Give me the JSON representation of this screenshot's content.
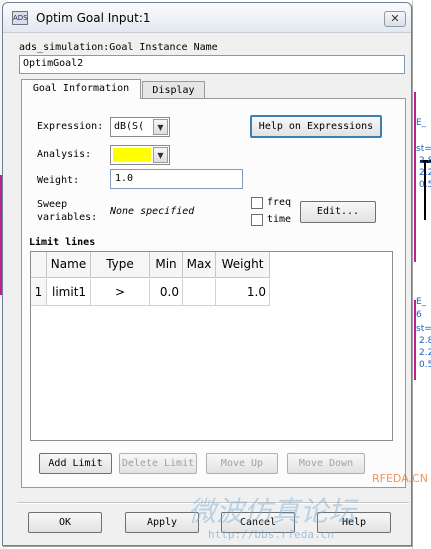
{
  "window": {
    "title": "Optim Goal Input:1",
    "close_symbol": "✕",
    "icon_text": "ADS"
  },
  "instance": {
    "label": "ads_simulation:Goal Instance Name",
    "value": "OptimGoal2"
  },
  "tabs": [
    {
      "label": "Goal Information",
      "active": true
    },
    {
      "label": "Display",
      "active": false
    }
  ],
  "form": {
    "expression_label": "Expression:",
    "expression_value": "dB(S(",
    "help_button": "Help on Expressions",
    "analysis_label": "Analysis:",
    "analysis_value": "",
    "analysis_color": "#ffff00",
    "weight_label": "Weight:",
    "weight_value": "1.0",
    "sweep_label_1": "Sweep",
    "sweep_label_2": "variables:",
    "sweep_value": "None specified",
    "freq_label": "freq",
    "time_label": "time",
    "edit_button": "Edit..."
  },
  "limit_lines": {
    "title": "Limit lines",
    "columns": [
      "Name",
      "Type",
      "Min",
      "Max",
      "Weight"
    ],
    "rows": [
      {
        "index": "1",
        "name": "limit1",
        "type": ">",
        "min": "0.0",
        "max": "",
        "weight": "1.0"
      }
    ]
  },
  "limit_buttons": {
    "add": "Add Limit",
    "delete": "Delete Limit",
    "move_up": "Move Up",
    "move_down": "Move Down"
  },
  "footer_buttons": {
    "ok": "OK",
    "apply": "Apply",
    "cancel": "Cancel",
    "help": "Help"
  },
  "background": {
    "right_labels": [
      "E_",
      "st=",
      "2.8",
      "2.2",
      "0.5",
      "E_",
      "6",
      "st=",
      "2.8",
      "2.2",
      "0.5"
    ],
    "left_labels": [
      "M",
      "r",
      "nm"
    ]
  },
  "watermark": {
    "brand": "RFEDA.CN",
    "chinese": "微波仿真论坛",
    "url": "http://bbs.rfeda.cn"
  },
  "colors": {
    "accent_focus": "#3c7fb1",
    "analysis_highlight": "#ffff00",
    "schematic_wire": "#c0208c",
    "schematic_text": "#2060c0"
  }
}
